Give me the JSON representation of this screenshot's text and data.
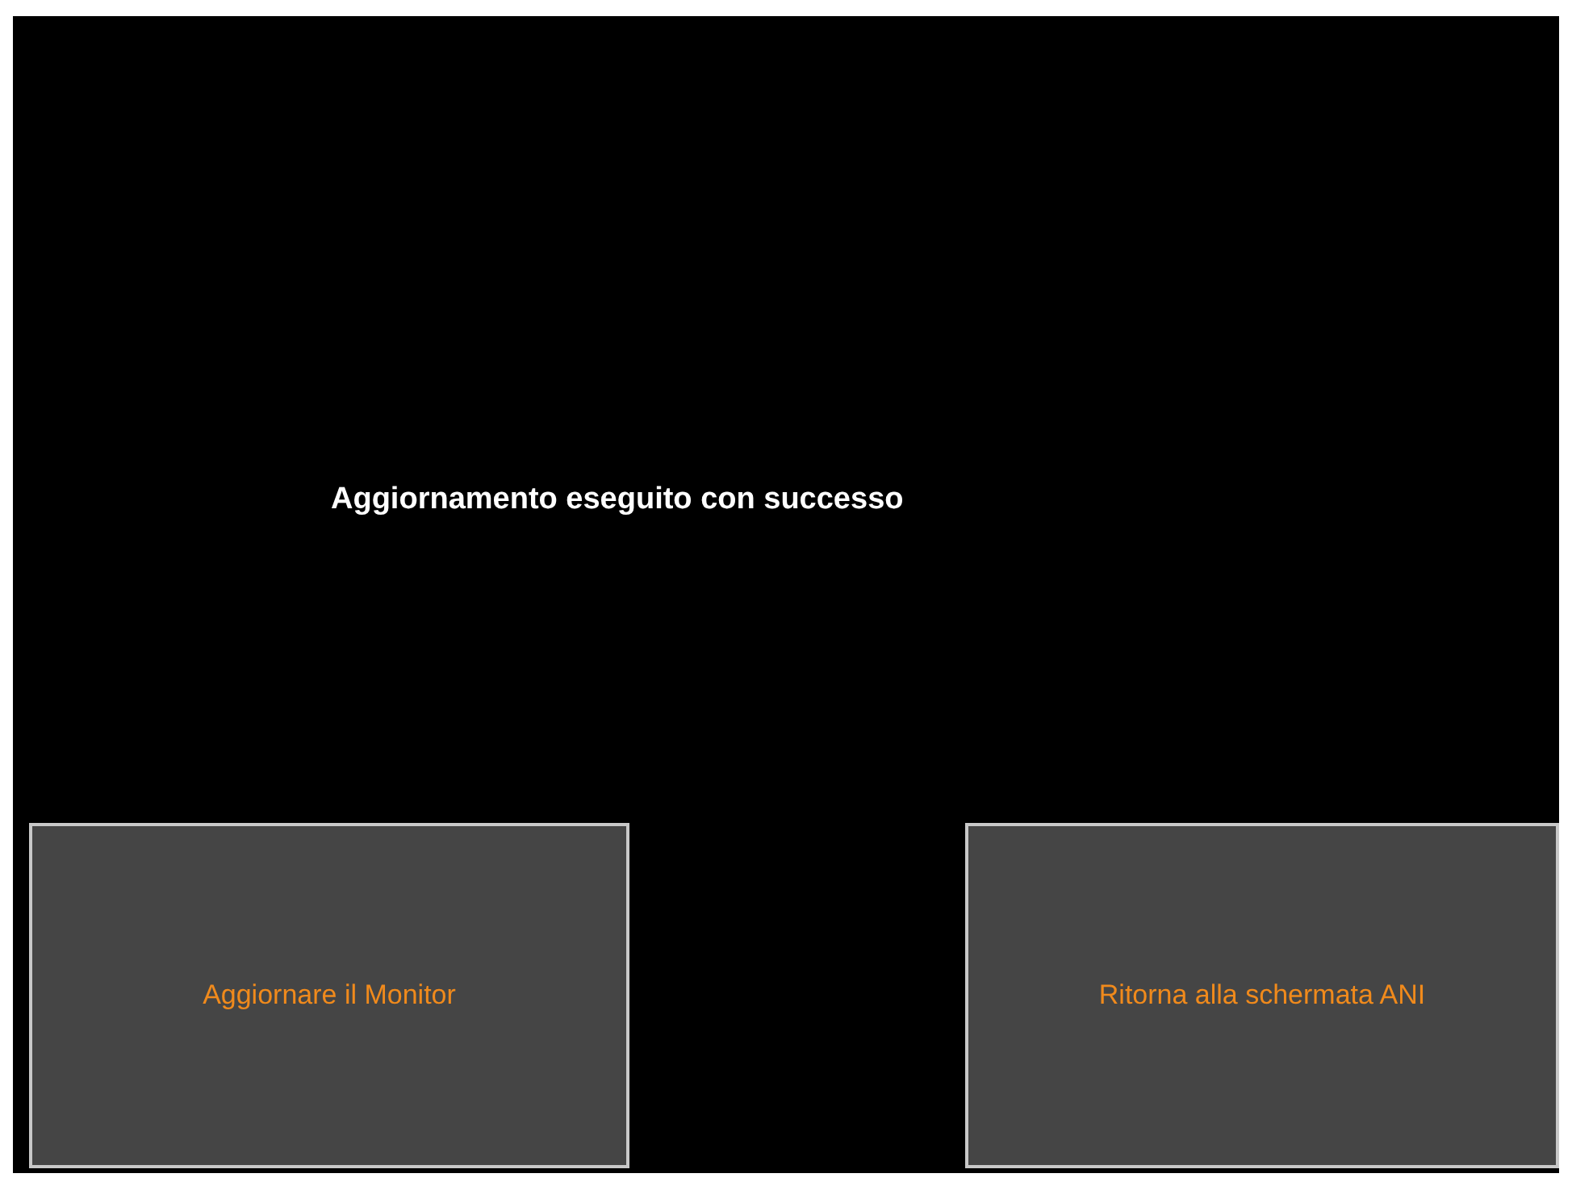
{
  "message": "Aggiornamento eseguito con successo",
  "buttons": [
    {
      "label": "Aggiornare il Monitor"
    },
    {
      "label": "Ritorna alla schermata ANI"
    }
  ]
}
